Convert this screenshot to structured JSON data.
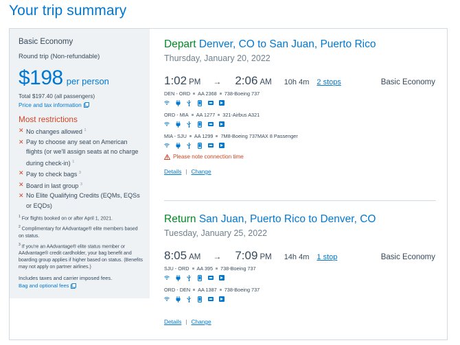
{
  "page": {
    "title": "Your trip summary"
  },
  "sidebar": {
    "fare_name": "Basic Economy",
    "trip_type": "Round trip (Non-refundable)",
    "price": "$198",
    "per_person": "per person",
    "total": "Total $197.40 (all passengers)",
    "tax_link": "Price and tax information",
    "restrictions_title": "Most restrictions",
    "restrictions": [
      {
        "text": "No changes allowed",
        "note": "1"
      },
      {
        "text": "Pay to choose any seat on American flights (or we'll assign seats at no charge during check-in)",
        "note": "1"
      },
      {
        "text": "Pay to check bags",
        "note": "3"
      },
      {
        "text": "Board in last group",
        "note": "3"
      },
      {
        "text": "No Elite Qualifying Credits (EQMs, EQSs or EQDs)",
        "note": ""
      }
    ],
    "notes": [
      {
        "num": "1",
        "text": "For flights booked on or after April 1, 2021."
      },
      {
        "num": "2",
        "text": "Complimentary for AAdvantage® elite members based on status."
      },
      {
        "num": "3",
        "text": "If you're an AAdvantage® elite status member or AAdvantage® credit cardholder, your bag benefit and boarding group applies if higher based on status. (Benefits may not apply on partner airlines.)"
      }
    ],
    "includes": "Includes taxes and carrier imposed fees.",
    "bag_link": "Bag and optional fees"
  },
  "depart": {
    "direction": "Depart",
    "route": "Denver, CO to San Juan, Puerto Rico",
    "date": "Thursday, January 20, 2022",
    "dep_time": "1:02",
    "dep_ampm": "PM",
    "arr_time": "2:06",
    "arr_ampm": "AM",
    "duration": "10h 4m",
    "stops": "2 stops",
    "cabin": "Basic Economy",
    "segments": [
      {
        "route": "DEN - ORD",
        "flight": "AA 2368",
        "aircraft": "738-Boeing 737"
      },
      {
        "route": "ORD - MIA",
        "flight": "AA 1277",
        "aircraft": "321-Airbus A321"
      },
      {
        "route": "MIA - SJU",
        "flight": "AA 1299",
        "aircraft": "7M8-Boeing 737MAX 8 Passenger"
      }
    ],
    "warning": "Please note connection time",
    "details_link": "Details",
    "change_link": "Change"
  },
  "return": {
    "direction": "Return",
    "route": "San Juan, Puerto Rico to Denver, CO",
    "date": "Tuesday, January 25, 2022",
    "dep_time": "8:05",
    "dep_ampm": "AM",
    "arr_time": "7:09",
    "arr_ampm": "PM",
    "duration": "14h 4m",
    "stops": "1 stop",
    "cabin": "Basic Economy",
    "segments": [
      {
        "route": "SJU - ORD",
        "flight": "AA 395",
        "aircraft": "738-Boeing 737"
      },
      {
        "route": "ORD - DEN",
        "flight": "AA 1387",
        "aircraft": "738-Boeing 737"
      }
    ],
    "details_link": "Details",
    "change_link": "Change"
  },
  "amenity_icons": [
    "wifi-icon",
    "power-icon",
    "usb-icon",
    "phone-icon",
    "tv-icon",
    "streaming-icon"
  ],
  "colors": {
    "accent": "#0078d2",
    "green": "#008a22",
    "alert": "#d14424",
    "sidebar_bg": "#eef2f5"
  }
}
